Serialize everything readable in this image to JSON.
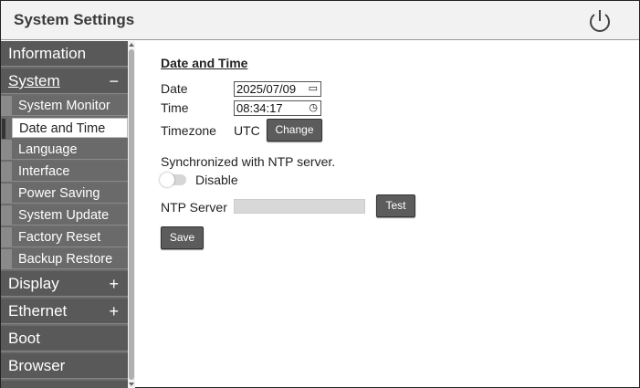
{
  "header": {
    "title": "System Settings",
    "power_icon": "power-icon"
  },
  "sidebar": {
    "sections": [
      {
        "label": "Information",
        "toggle": ""
      },
      {
        "label": "System",
        "toggle": "−"
      },
      {
        "label": "Display",
        "toggle": "+"
      },
      {
        "label": "Ethernet",
        "toggle": "+"
      },
      {
        "label": "Boot",
        "toggle": ""
      },
      {
        "label": "Browser",
        "toggle": ""
      }
    ],
    "system_items": [
      "System Monitor",
      "Date and Time",
      "Language",
      "Interface",
      "Power Saving",
      "System Update",
      "Factory Reset",
      "Backup Restore"
    ],
    "selected_item": "Date and Time"
  },
  "main": {
    "heading": "Date and Time",
    "date_label": "Date",
    "date_value": "2025/07/09",
    "time_label": "Time",
    "time_value": "08:34:17",
    "timezone_label": "Timezone",
    "timezone_value": "UTC",
    "change_button": "Change",
    "ntp_sync_text": "Synchronized with NTP server.",
    "ntp_toggle_label": "Disable",
    "ntp_server_label": "NTP Server",
    "ntp_server_value": "",
    "test_button": "Test",
    "save_button": "Save"
  },
  "colors": {
    "sidebar_bg": "#6c6c6c",
    "button_bg": "#5c5c5c",
    "header_bg": "#f2f2f2"
  }
}
